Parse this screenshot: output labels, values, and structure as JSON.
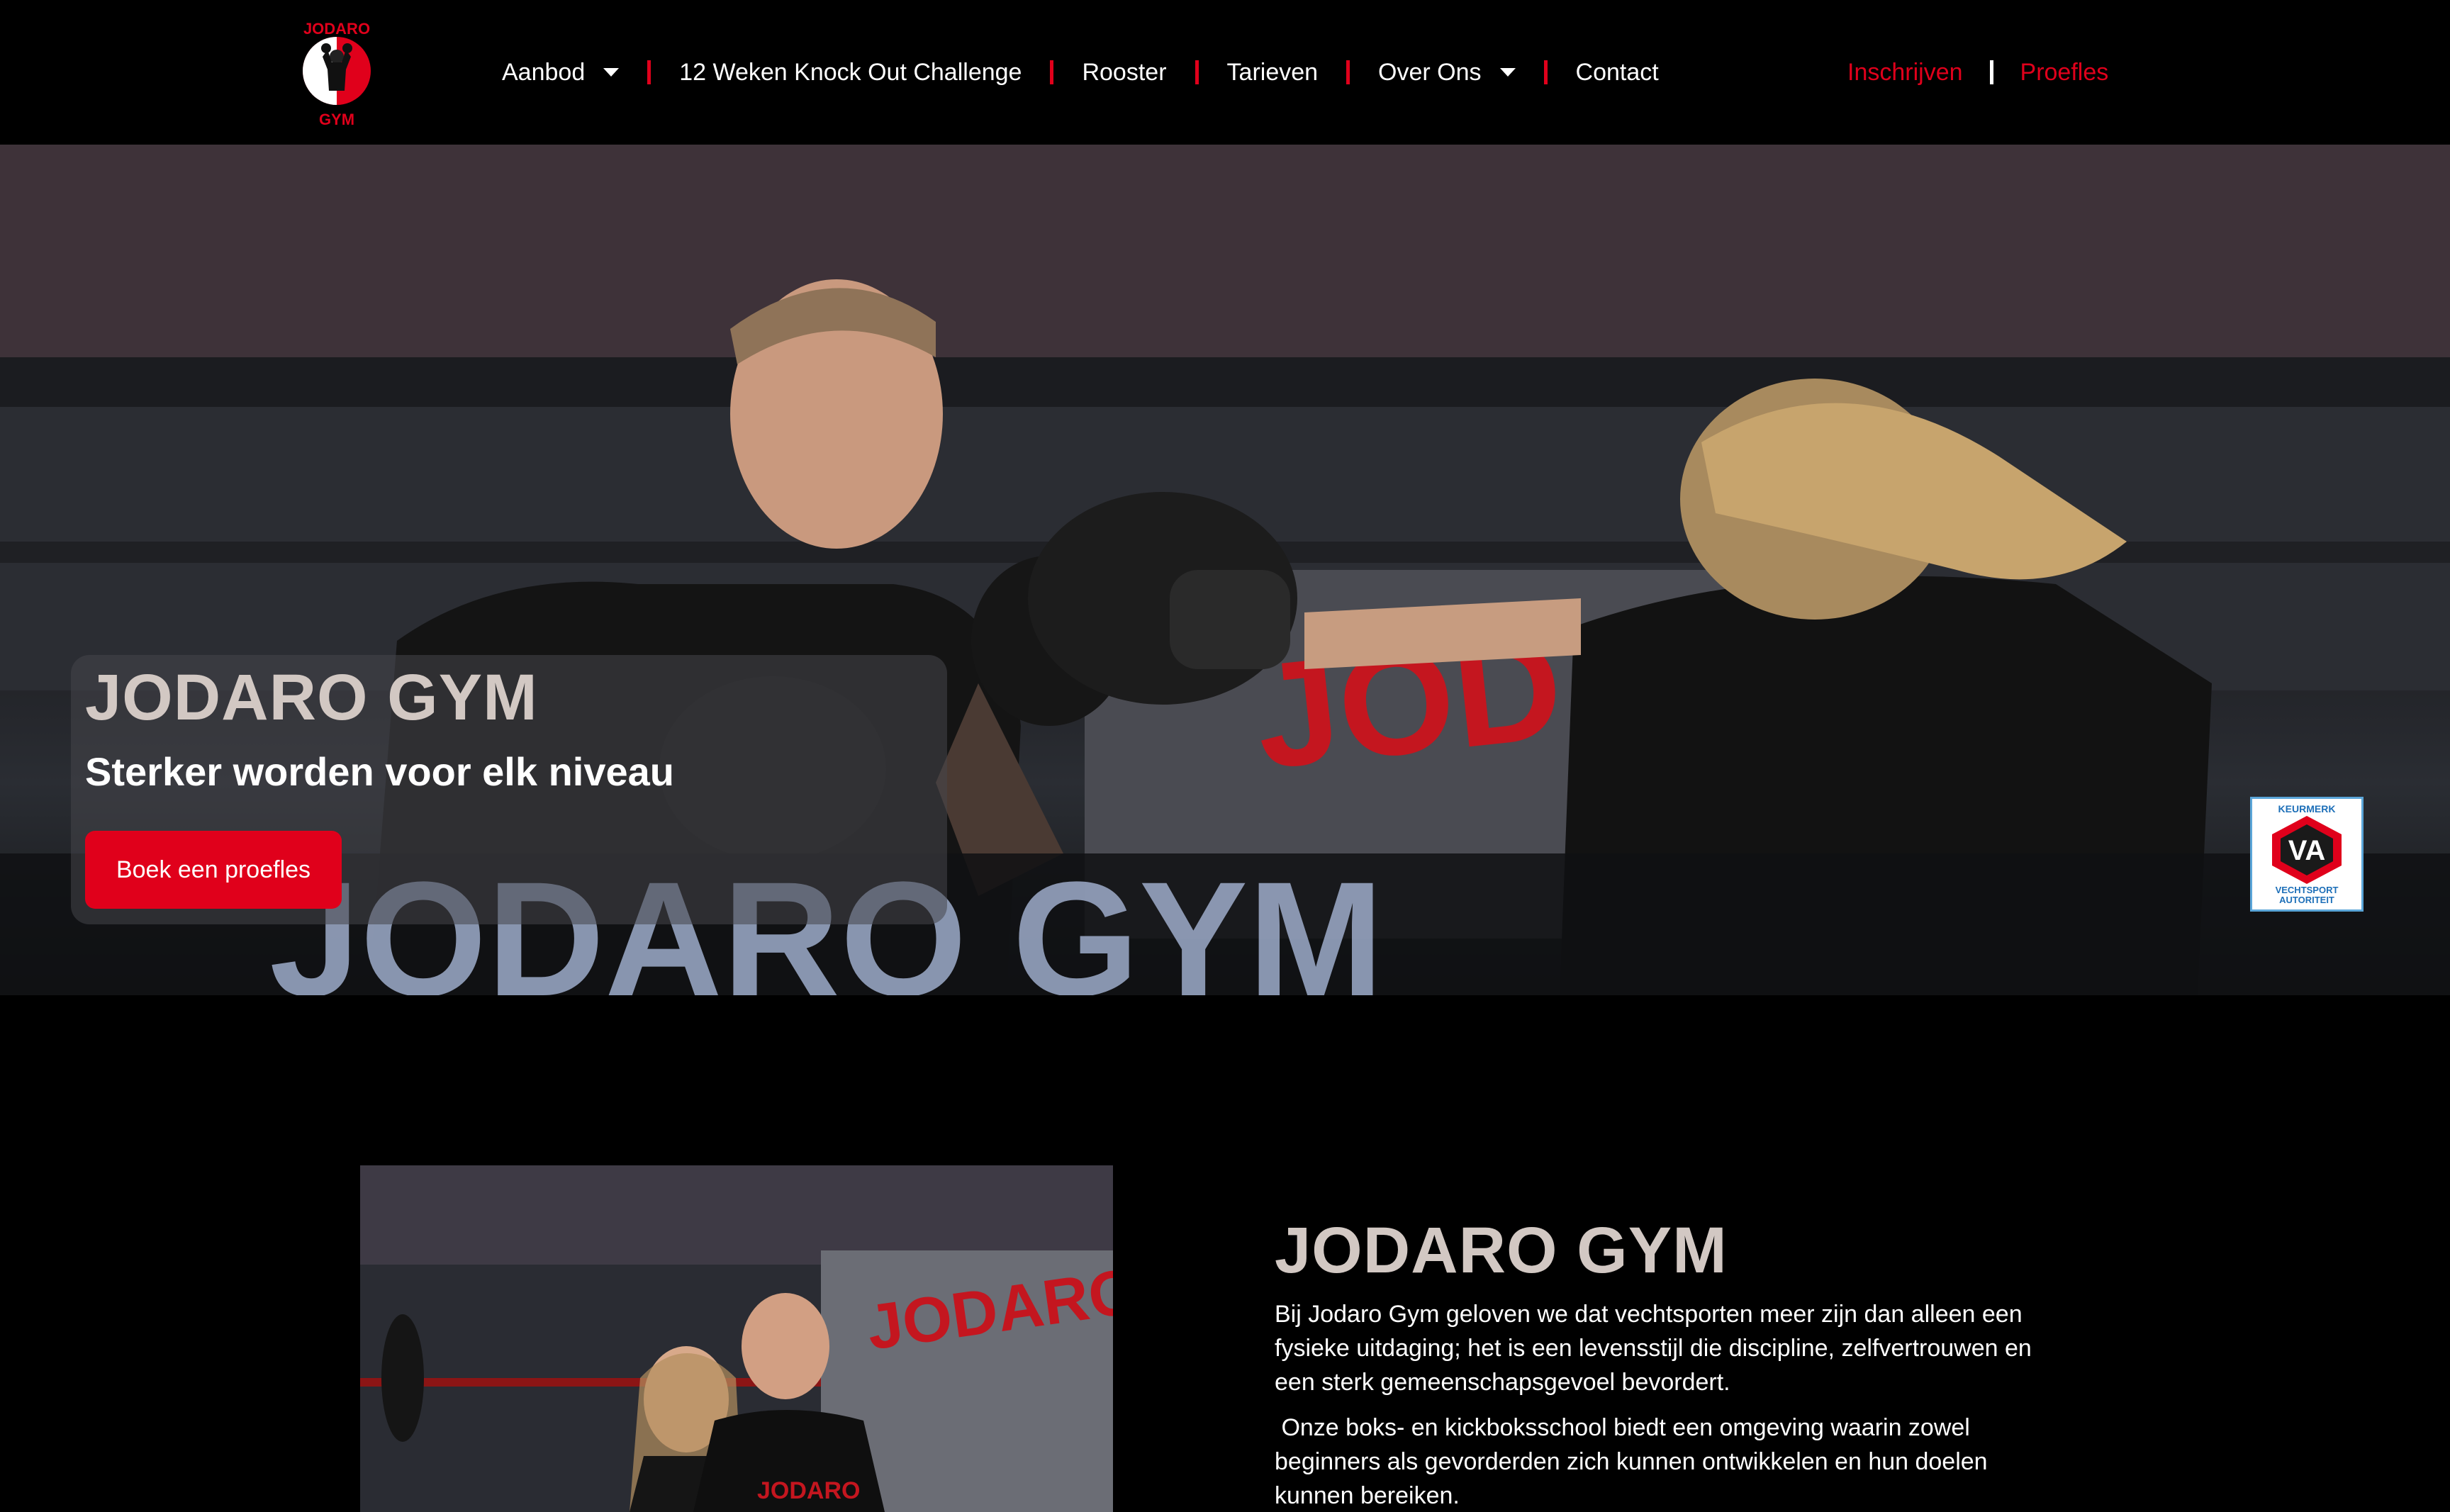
{
  "nav": {
    "items": [
      {
        "label": "Aanbod",
        "dropdown": true
      },
      {
        "label": "12 Weken Knock Out Challenge",
        "dropdown": false
      },
      {
        "label": "Rooster",
        "dropdown": false
      },
      {
        "label": "Tarieven",
        "dropdown": false
      },
      {
        "label": "Over Ons",
        "dropdown": true
      },
      {
        "label": "Contact",
        "dropdown": false
      }
    ],
    "cta_primary": "Inschrijven",
    "cta_secondary": "Proefles"
  },
  "logo": {
    "top_text": "JODARO",
    "bottom_text": "GYM"
  },
  "hero": {
    "title": "JODARO GYM",
    "subtitle": "Sterker worden voor elk niveau",
    "button": "Boek een proefles",
    "banner_text": "JODARO",
    "ring_text": "JODARO GYM",
    "badge": {
      "top": "KEURMERK",
      "mark": "VA",
      "bottom_line1": "VECHTSPORT",
      "bottom_line2": "AUTORITEIT"
    }
  },
  "about": {
    "title": "JODARO GYM",
    "paragraphs": [
      "Bij Jodaro Gym geloven we dat vechtsporten meer zijn dan alleen een fysieke uitdaging; het is een levensstijl die discipline, zelfvertrouwen en een sterk gemeenschapsgevoel bevordert.",
      " Onze boks- en kickboksschool biedt een omgeving waarin zowel beginners als gevorderden zich kunnen ontwikkelen en hun doelen kunnen bereiken."
    ],
    "banner_text": "JODARO",
    "shirt_text": "JODARO"
  },
  "colors": {
    "accent": "#e0001b",
    "background": "#000000",
    "title": "#d2c8c3"
  }
}
